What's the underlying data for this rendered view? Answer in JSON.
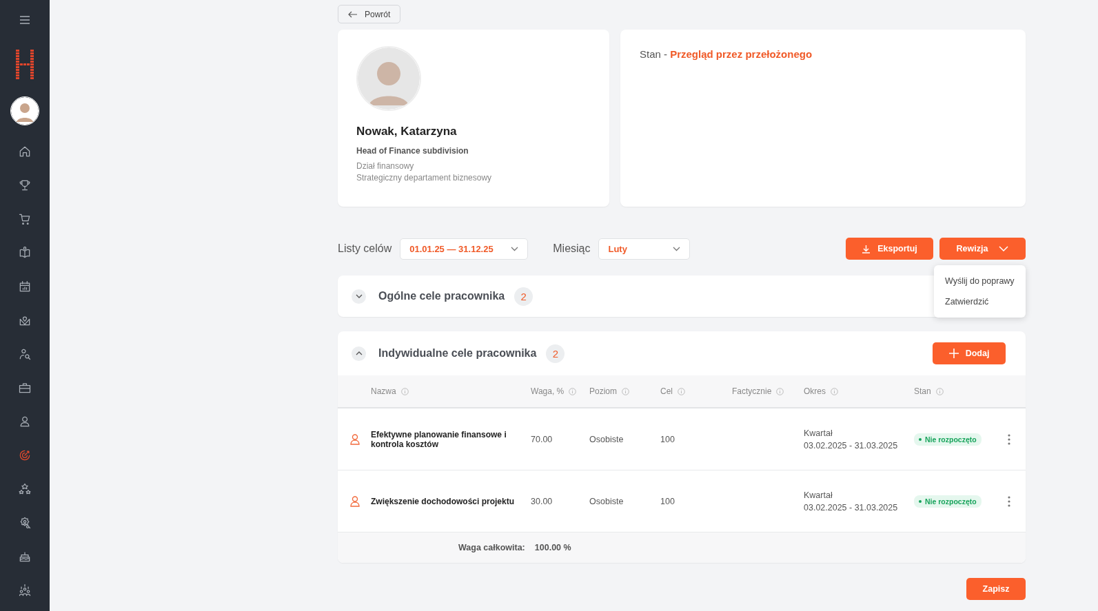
{
  "sidebar": {
    "items": [
      {
        "selected": false
      },
      {
        "selected": false
      },
      {
        "selected": false
      },
      {
        "selected": false
      },
      {
        "selected": false
      },
      {
        "selected": false
      },
      {
        "selected": false
      },
      {
        "selected": false
      },
      {
        "selected": false
      },
      {
        "selected": true
      },
      {
        "selected": false
      },
      {
        "selected": false
      },
      {
        "selected": false
      },
      {
        "selected": false
      }
    ]
  },
  "back_button": "Powrót",
  "profile": {
    "name": "Nowak, Katarzyna",
    "position": "Head of Finance subdivision",
    "department": "Dział finansowy",
    "division": "Strategiczny departament biznesowy"
  },
  "status": {
    "label": "Stan - ",
    "value": "Przegląd przez przełożonego"
  },
  "filters": [
    {
      "label": "Listy celów",
      "value": "01.01.25 — 31.12.25"
    },
    {
      "label": "Miesiąc",
      "value": "Luty"
    }
  ],
  "actions": {
    "export": "Eksportuj",
    "review": "Rewizja",
    "review_menu": [
      "Wyślij do poprawy",
      "Zatwierdzić"
    ]
  },
  "sections": [
    {
      "title": "Ogólne cele pracownika",
      "count": "2",
      "expanded": false
    },
    {
      "title": "Indywidualne cele pracownika",
      "count": "2",
      "expanded": true,
      "add_button": "Dodaj",
      "columns": [
        "Nazwa",
        "Waga, %",
        "Poziom",
        "Cel",
        "Factycznie",
        "Okres",
        "Stan"
      ],
      "rows": [
        {
          "name": "Efektywne planowanie finansowe i kontrola kosztów",
          "weight": "70.00",
          "level": "Osobiste",
          "target": "100",
          "period": "Kwartał",
          "dates": "03.02.2025 - 31.03.2025",
          "state": "Nie rozpoczęto"
        },
        {
          "name": "Zwiększenie dochodowości projektu",
          "weight": "30.00",
          "level": "Osobiste",
          "target": "100",
          "period": "Kwartał",
          "dates": "03.02.2025 - 31.03.2025",
          "state": "Nie rozpoczęto"
        }
      ],
      "total_label": "Waga całkowita:",
      "total_value": "100.00 %"
    }
  ],
  "save_button": "Zapisz"
}
